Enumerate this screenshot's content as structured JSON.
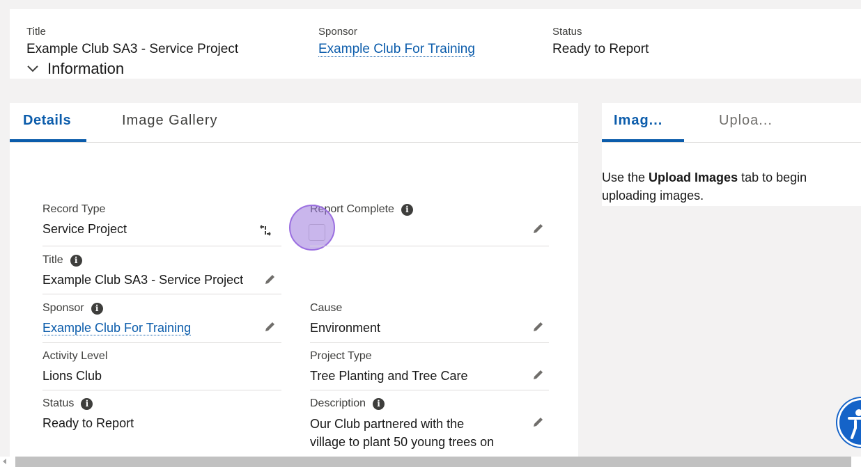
{
  "header": {
    "title_label": "Title",
    "title_value": "Example Club SA3 - Service Project",
    "sponsor_label": "Sponsor",
    "sponsor_value": "Example Club For Training",
    "status_label": "Status",
    "status_value": "Ready to Report"
  },
  "tabs": {
    "details": "Details",
    "gallery": "Image Gallery"
  },
  "section": {
    "title": "Information"
  },
  "fields": {
    "record_type": {
      "label": "Record Type",
      "value": "Service Project"
    },
    "report_complete": {
      "label": "Report Complete",
      "checked": false
    },
    "title": {
      "label": "Title",
      "value": "Example Club SA3 - Service Project"
    },
    "sponsor": {
      "label": "Sponsor",
      "value": "Example Club For Training"
    },
    "cause": {
      "label": "Cause",
      "value": "Environment"
    },
    "activity_level": {
      "label": "Activity Level",
      "value": "Lions Club"
    },
    "project_type": {
      "label": "Project Type",
      "value": "Tree Planting and Tree Care"
    },
    "status": {
      "label": "Status",
      "value": "Ready to Report"
    },
    "description": {
      "label": "Description",
      "line1": "Our Club partnered with the",
      "line2": "village to plant 50 young trees on"
    }
  },
  "right_panel": {
    "tab_images": "Imag...",
    "tab_upload": "Uploa...",
    "text_before": "Use the ",
    "text_bold": "Upload Images",
    "text_after": " tab to begin uploading images."
  },
  "colors": {
    "accent": "#0b5cab",
    "highlight": "#9b6fe0",
    "a11y": "#1463c8"
  }
}
